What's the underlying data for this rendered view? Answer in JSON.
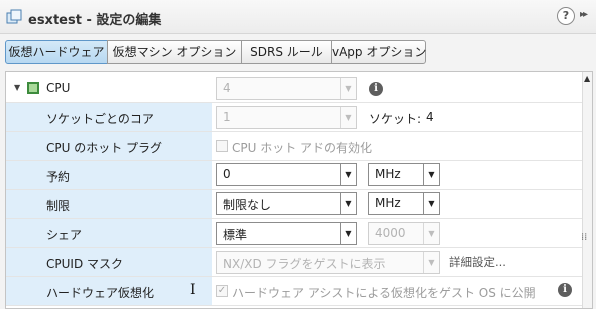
{
  "window": {
    "title": "esxtest - 設定の編集",
    "help_glyph": "?",
    "more_glyph": "▸▸"
  },
  "tabs": [
    {
      "label": "仮想ハードウェア",
      "active": true
    },
    {
      "label": "仮想マシン オプション",
      "active": false
    },
    {
      "label": "SDRS ルール",
      "active": false
    },
    {
      "label": "vApp オプション",
      "active": false
    }
  ],
  "rows": {
    "cpu": {
      "label": "CPU",
      "value": "4"
    },
    "cores": {
      "label": "ソケットごとのコア",
      "value": "1",
      "sockets_label": "ソケット:",
      "sockets_value": "4"
    },
    "hotplug": {
      "label": "CPU のホット プラグ",
      "checkbox_label": "CPU ホット アドの有効化",
      "checked": false
    },
    "reservation": {
      "label": "予約",
      "value": "0",
      "unit": "MHz"
    },
    "limit": {
      "label": "制限",
      "value": "制限なし",
      "unit": "MHz"
    },
    "shares": {
      "label": "シェア",
      "value": "標準",
      "amount": "4000"
    },
    "cpuid": {
      "label": "CPUID マスク",
      "value": "NX/XD フラグをゲストに表示",
      "advanced_link": "詳細設定..."
    },
    "hwvirt": {
      "label": "ハードウェア仮想化",
      "checkbox_label": "ハードウェア アシストによる仮想化をゲスト OS に公開",
      "checked": true
    }
  },
  "icons": {
    "info": "i",
    "checkmark": "✓",
    "dropdown": "▼",
    "expand": "▼",
    "scroll_up": "▲",
    "resize_grip": "⁞⁞"
  },
  "colors": {
    "label_bg": "#dfeefa",
    "active_tab": "#c4e0f5",
    "cpu_icon": "#3d8b3d"
  }
}
